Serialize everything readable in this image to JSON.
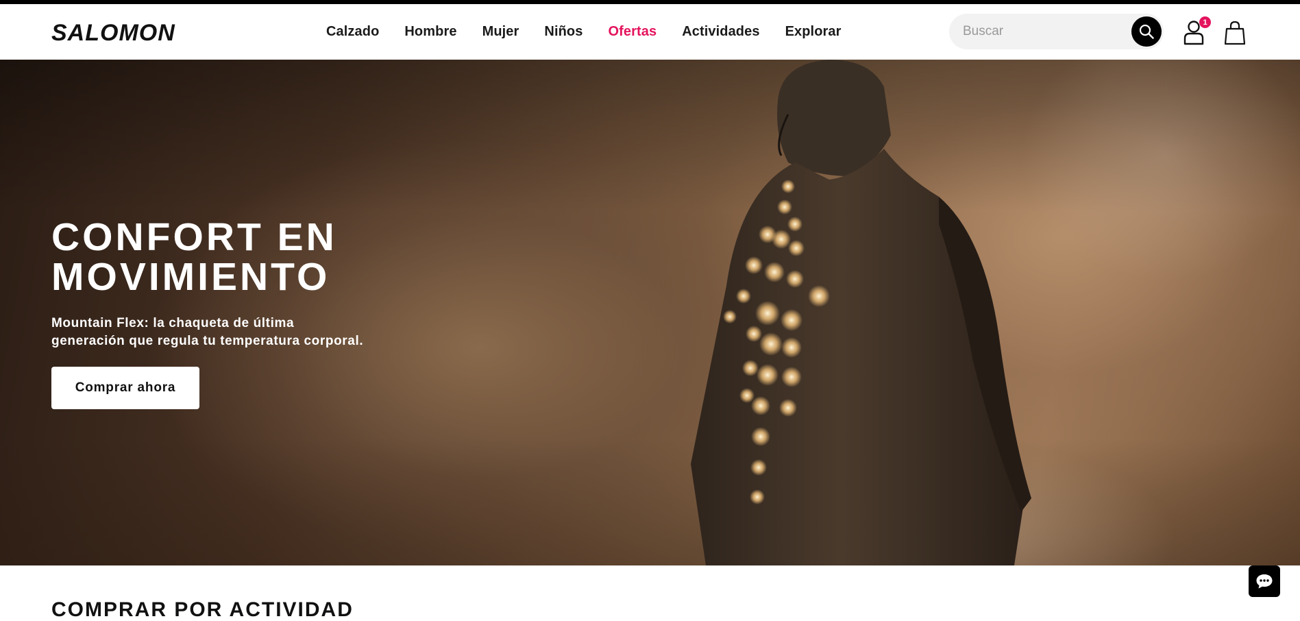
{
  "brand": {
    "logo_text": "SALOMON"
  },
  "nav": {
    "items": [
      {
        "label": "Calzado"
      },
      {
        "label": "Hombre"
      },
      {
        "label": "Mujer"
      },
      {
        "label": "Niños"
      },
      {
        "label": "Ofertas",
        "accent": "#e4135d"
      },
      {
        "label": "Actividades"
      },
      {
        "label": "Explorar"
      }
    ]
  },
  "search": {
    "placeholder": "Buscar",
    "icon": "search-icon"
  },
  "account": {
    "icon": "user-icon",
    "badge_count": "1",
    "badge_color": "#e4135d"
  },
  "cart": {
    "icon": "shopping-bag-icon"
  },
  "hero": {
    "title_line1": "CONFORT EN",
    "title_line2": "MOVIMIENTO",
    "subtitle_line1": "Mountain Flex: la chaqueta de última",
    "subtitle_line2": "generación que regula tu temperatura corporal.",
    "cta_label": "Comprar ahora"
  },
  "section": {
    "title": "COMPRAR POR ACTIVIDAD"
  },
  "chat": {
    "icon": "chat-bubble-icon"
  }
}
